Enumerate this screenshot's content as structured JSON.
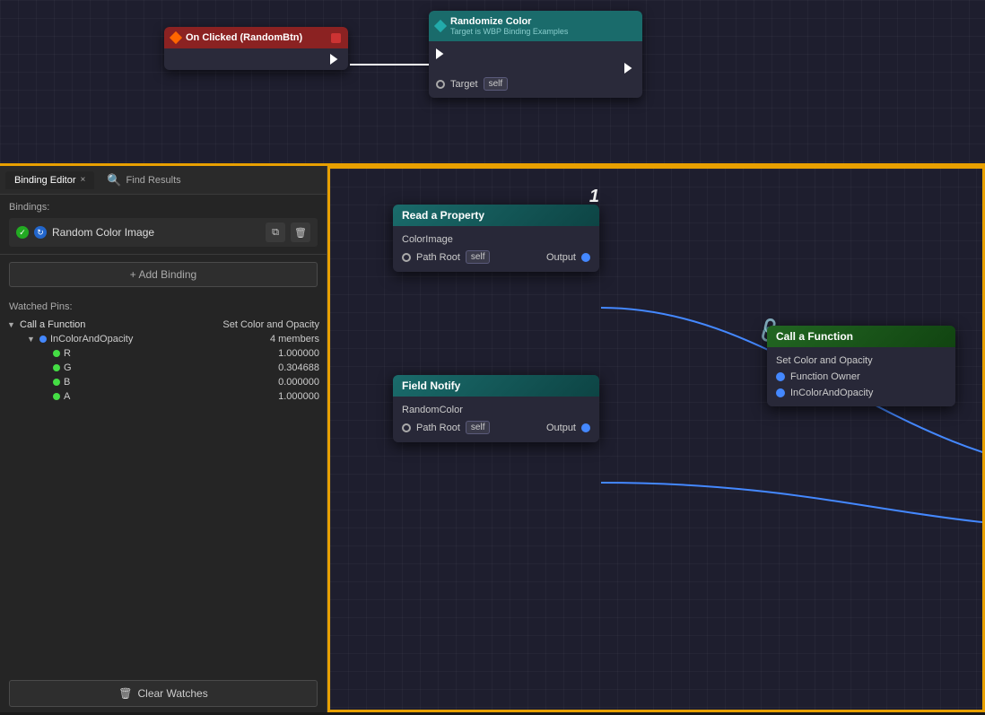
{
  "tabs": {
    "binding_editor": "Binding Editor",
    "find_results": "Find Results",
    "close_icon": "×"
  },
  "bindings": {
    "label": "Bindings:",
    "item": {
      "name": "Random Color Image",
      "copy_icon": "⧉",
      "delete_icon": "🗑"
    }
  },
  "add_binding": "+ Add Binding",
  "watched_pins": {
    "label": "Watched Pins:",
    "group": {
      "name": "Call a Function",
      "value": "Set Color and Opacity",
      "sub_group": {
        "name": "InColorAndOpacity",
        "value": "4 members",
        "items": [
          {
            "name": "R",
            "value": "1.000000"
          },
          {
            "name": "G",
            "value": "0.304688"
          },
          {
            "name": "B",
            "value": "0.000000"
          },
          {
            "name": "A",
            "value": "1.000000"
          }
        ]
      }
    }
  },
  "clear_watches": "Clear Watches",
  "top_nodes": {
    "event_node": {
      "title": "On Clicked (RandomBtn)",
      "diamond_icon": "◆"
    },
    "randomize_node": {
      "title": "Randomize Color",
      "subtitle": "Target is WBP Binding Examples",
      "target_label": "Target",
      "self_badge": "self"
    }
  },
  "canvas_nodes": {
    "read_property": {
      "title": "Read a Property",
      "sub_label": "ColorImage",
      "path_root_label": "Path Root",
      "self_badge": "self",
      "output_label": "Output",
      "number": "1"
    },
    "field_notify": {
      "title": "Field Notify",
      "sub_label": "RandomColor",
      "path_root_label": "Path Root",
      "self_badge": "self",
      "output_label": "Output"
    },
    "call_function": {
      "title": "Call a Function",
      "sub_label": "Set Color and Opacity",
      "function_owner_label": "Function Owner",
      "in_color_label": "InColorAndOpacity"
    }
  }
}
